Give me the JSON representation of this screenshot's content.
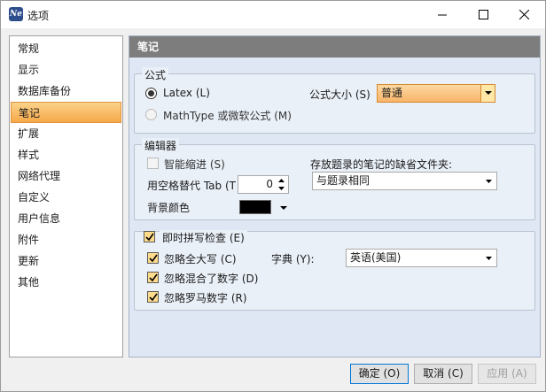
{
  "window": {
    "title": "选项",
    "app_icon_text": "Ne"
  },
  "sidebar": {
    "items": [
      {
        "label": "常规"
      },
      {
        "label": "显示"
      },
      {
        "label": "数据库备份"
      },
      {
        "label": "笔记",
        "active": true
      },
      {
        "label": "扩展"
      },
      {
        "label": "样式"
      },
      {
        "label": "网络代理"
      },
      {
        "label": "自定义"
      },
      {
        "label": "用户信息"
      },
      {
        "label": "附件"
      },
      {
        "label": "更新"
      },
      {
        "label": "其他"
      }
    ]
  },
  "main": {
    "header": "笔记",
    "formula": {
      "title": "公式",
      "latex_label": "Latex (L)",
      "latex_selected": true,
      "mathtype_label": "MathType 或微软公式 (M)",
      "mathtype_enabled": false,
      "size_label": "公式大小 (S)",
      "size_value": "普通"
    },
    "editor": {
      "title": "编辑器",
      "smart_indent_label": "智能缩进 (S)",
      "smart_indent_enabled": false,
      "tab_label": "用空格替代 Tab (T",
      "tab_value": "0",
      "bg_color_label": "背景颜色",
      "bg_color": "#000000",
      "folder_label": "存放题录的笔记的缺省文件夹:",
      "folder_value": "与题录相同"
    },
    "spellcheck": {
      "enable_label": "即时拼写检查 (E)",
      "enabled": true,
      "ignore_caps_label": "忽略全大写 (C)",
      "ignore_digits_label": "忽略混合了数字 (D)",
      "ignore_roman_label": "忽略罗马数字 (R)",
      "dict_label": "字典 (Y):",
      "dict_value": "英语(美国)"
    }
  },
  "footer": {
    "ok_label": "确定 (O)",
    "cancel_label": "取消 (C)",
    "apply_label": "应用 (A)"
  },
  "colors": {
    "accent_orange": "#f7a84a",
    "header_gray": "#7d7d7d",
    "panel_bg": "#dee7f3"
  }
}
